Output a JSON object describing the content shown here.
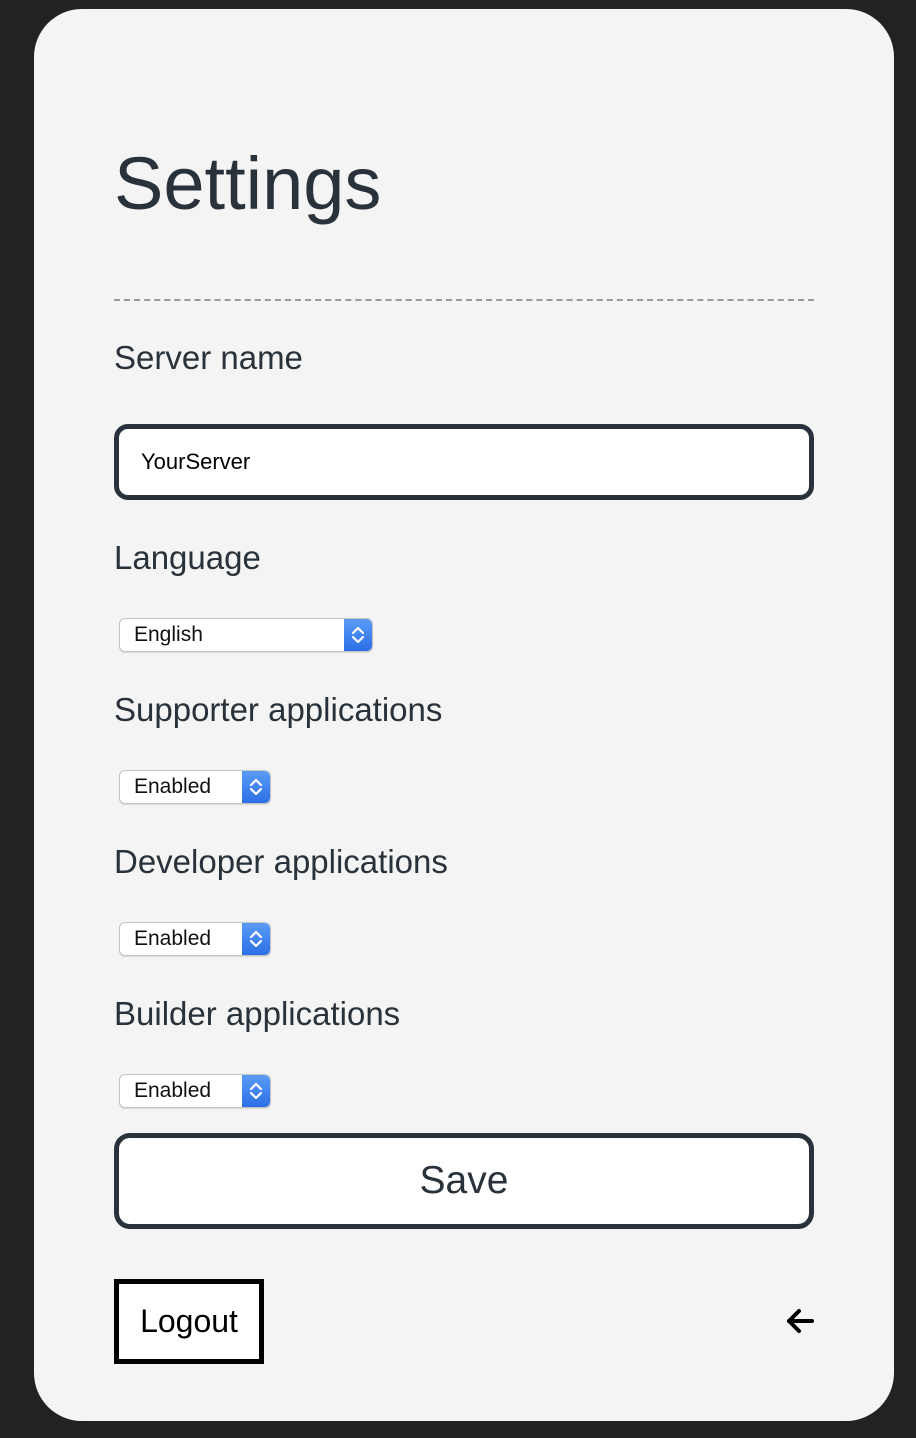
{
  "settings": {
    "title": "Settings",
    "server_name": {
      "label": "Server name",
      "value": "YourServer"
    },
    "language": {
      "label": "Language",
      "selected": "English"
    },
    "supporter_applications": {
      "label": "Supporter applications",
      "selected": "Enabled"
    },
    "developer_applications": {
      "label": "Developer applications",
      "selected": "Enabled"
    },
    "builder_applications": {
      "label": "Builder applications",
      "selected": "Enabled"
    },
    "save_label": "Save",
    "logout_label": "Logout",
    "back_icon": "arrow-left-icon"
  },
  "colors": {
    "page_background": "#222222",
    "card_background": "#f4f4f4",
    "text": "#29323a",
    "select_accent": "#2b6fe6"
  }
}
